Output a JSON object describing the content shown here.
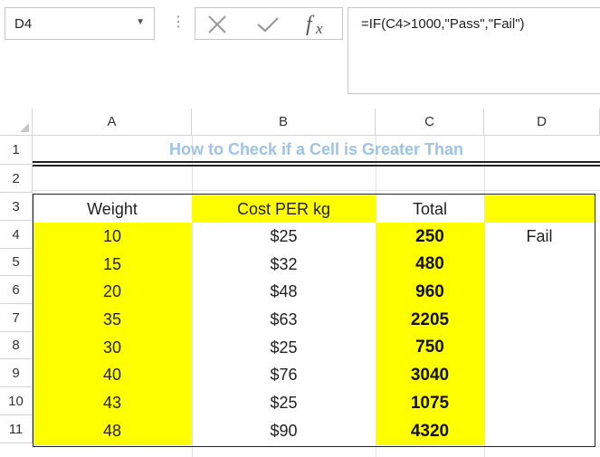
{
  "formula_bar": {
    "name_box": "D4",
    "separator": "⋮",
    "formula": "=IF(C4>1000,\"Pass\",\"Fail\")"
  },
  "sheet": {
    "columns": [
      "A",
      "B",
      "C",
      "D"
    ],
    "rows": [
      "1",
      "2",
      "3",
      "4",
      "5",
      "6",
      "7",
      "8",
      "9",
      "10",
      "11"
    ],
    "title": "How to Check if a Cell is Greater Than",
    "header": {
      "a": "Weight",
      "b": "Cost PER kg",
      "c": "Total",
      "d": ""
    },
    "data": [
      {
        "a": "10",
        "b": "$25",
        "c": "250",
        "d": "Fail"
      },
      {
        "a": "15",
        "b": "$32",
        "c": "480",
        "d": ""
      },
      {
        "a": "20",
        "b": "$48",
        "c": "960",
        "d": ""
      },
      {
        "a": "35",
        "b": "$63",
        "c": "2205",
        "d": ""
      },
      {
        "a": "30",
        "b": "$25",
        "c": "750",
        "d": ""
      },
      {
        "a": "40",
        "b": "$76",
        "c": "3040",
        "d": ""
      },
      {
        "a": "43",
        "b": "$25",
        "c": "1075",
        "d": ""
      },
      {
        "a": "48",
        "b": "$90",
        "c": "4320",
        "d": ""
      }
    ]
  },
  "colors": {
    "highlight": "#ffff00",
    "title": "#9dc3e6"
  }
}
